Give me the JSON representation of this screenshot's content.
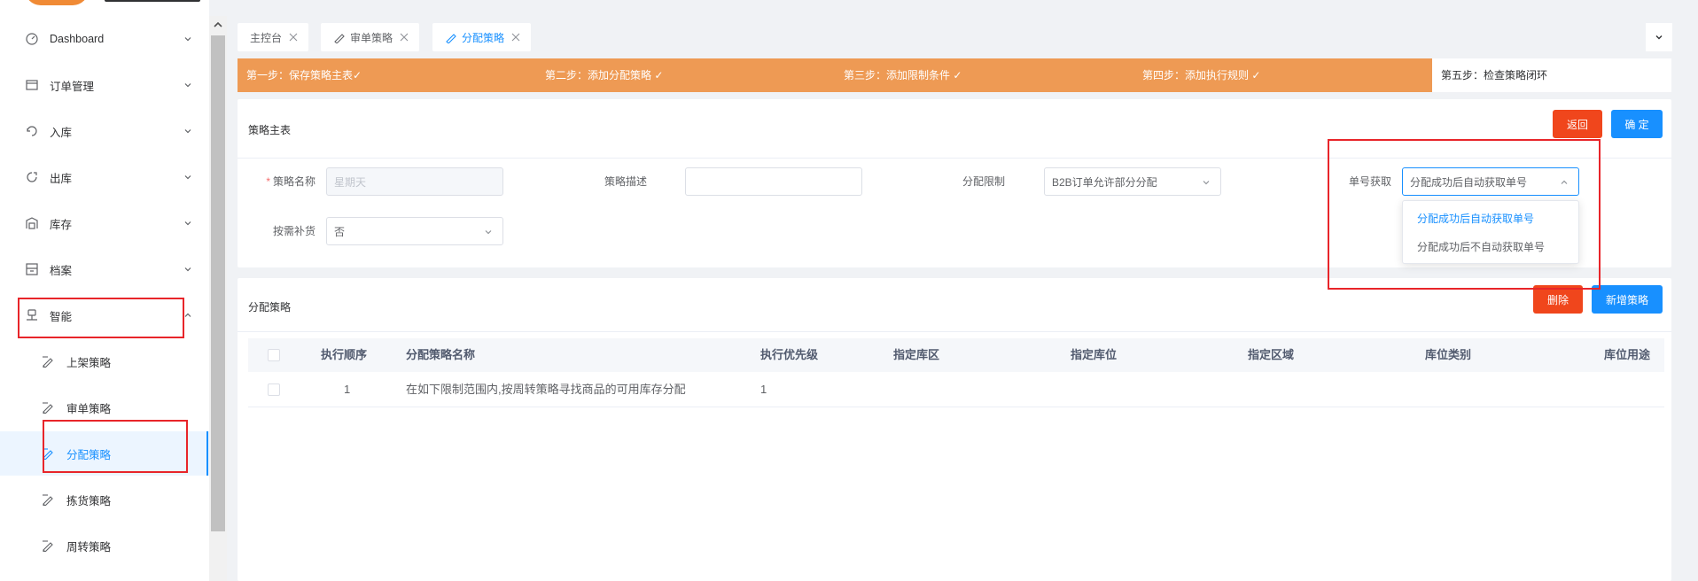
{
  "sidebar": {
    "items": [
      {
        "label": "Dashboard",
        "icon": "dashboard-icon"
      },
      {
        "label": "订单管理",
        "icon": "order-icon"
      },
      {
        "label": "入库",
        "icon": "inbound-icon"
      },
      {
        "label": "出库",
        "icon": "outbound-icon"
      },
      {
        "label": "库存",
        "icon": "inventory-icon"
      },
      {
        "label": "档案",
        "icon": "archive-icon"
      },
      {
        "label": "智能",
        "icon": "smart-icon"
      }
    ],
    "sub_items": [
      {
        "label": "上架策略",
        "icon": "strategy-icon"
      },
      {
        "label": "审单策略",
        "icon": "strategy-icon"
      },
      {
        "label": "分配策略",
        "icon": "strategy-icon"
      },
      {
        "label": "拣货策略",
        "icon": "strategy-icon"
      },
      {
        "label": "周转策略",
        "icon": "strategy-icon"
      }
    ]
  },
  "tabs": [
    {
      "label": "主控台"
    },
    {
      "label": "审单策略"
    },
    {
      "label": "分配策略"
    }
  ],
  "steps": [
    {
      "label": "第一步：保存策略主表✓"
    },
    {
      "label": "第二步：添加分配策略 ✓"
    },
    {
      "label": "第三步：添加限制条件 ✓"
    },
    {
      "label": "第四步：添加执行规则 ✓"
    },
    {
      "label": "第五步：检查策略闭环"
    }
  ],
  "main_panel": {
    "title": "策略主表",
    "back_label": "返回",
    "confirm_label": "确 定",
    "fields": {
      "name_label": "策略名称",
      "name_placeholder": "星期天",
      "desc_label": "策略描述",
      "desc_value": "",
      "limit_label": "分配限制",
      "limit_value": "B2B订单允许部分分配",
      "number_label": "单号获取",
      "number_value": "分配成功后自动获取单号",
      "replenish_label": "按需补货",
      "replenish_value": "否"
    },
    "dropdown_options": [
      {
        "label": "分配成功后自动获取单号",
        "selected": true
      },
      {
        "label": "分配成功后不自动获取单号",
        "selected": false
      }
    ]
  },
  "alloc_panel": {
    "title": "分配策略",
    "delete_label": "删除",
    "add_label": "新增策略",
    "columns": [
      "执行顺序",
      "分配策略名称",
      "执行优先级",
      "指定库区",
      "指定库位",
      "指定区域",
      "库位类别",
      "库位用途"
    ],
    "rows": [
      {
        "order": "1",
        "name": "在如下限制范围内,按周转策略寻找商品的可用库存分配",
        "priority": "1"
      }
    ]
  },
  "colors": {
    "accent": "#1890ff",
    "steps_done": "#ee9a54",
    "danger": "#f0461c",
    "annotation": "#e8252a"
  }
}
